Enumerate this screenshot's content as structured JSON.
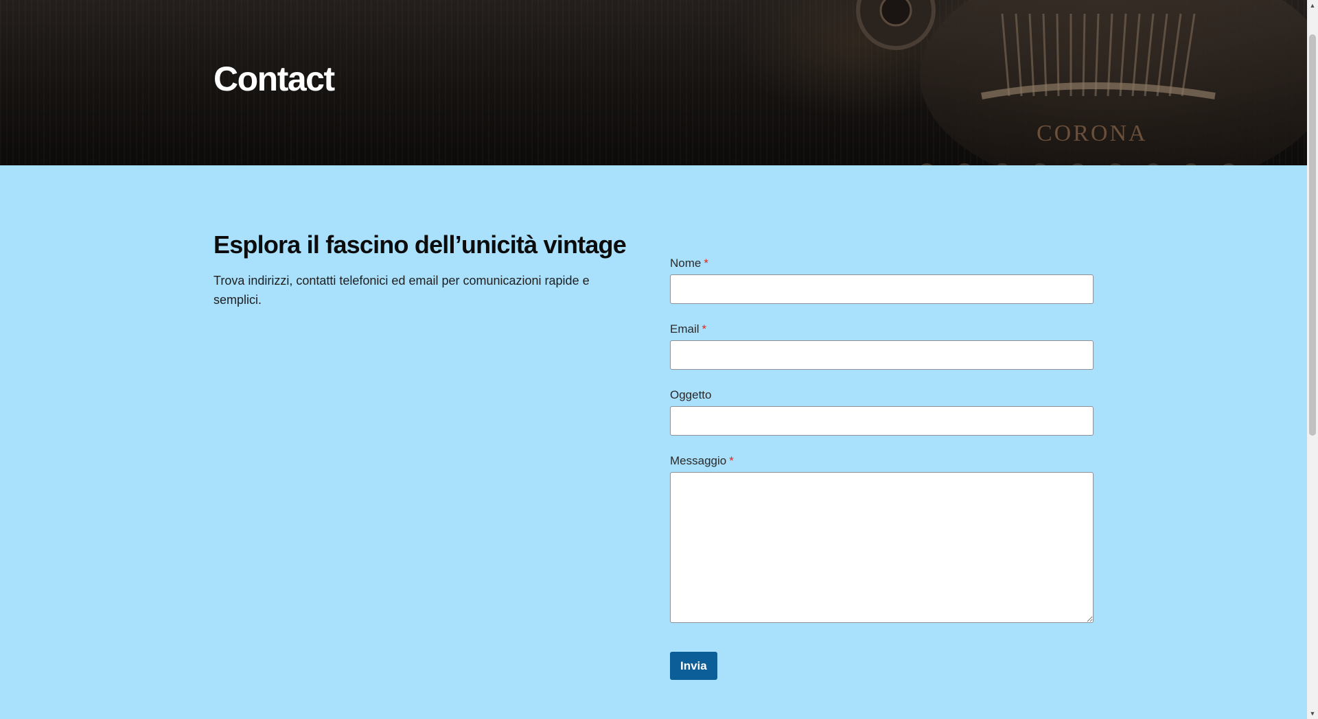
{
  "hero": {
    "title": "Contact",
    "background": "vintage-typewriter-photo",
    "typewriter_brand": "CORONA"
  },
  "intro": {
    "heading": "Esplora il fascino dell’unicità vintage",
    "text": "Trova indirizzi, contatti telefonici ed email per comunicazioni rapide e semplici."
  },
  "form": {
    "fields": [
      {
        "label": "Nome",
        "required": true,
        "value": ""
      },
      {
        "label": "Email",
        "required": true,
        "value": ""
      },
      {
        "label": "Oggetto",
        "required": false,
        "value": ""
      },
      {
        "label": "Messaggio",
        "required": true,
        "value": ""
      }
    ],
    "required_marker": "*",
    "submit_label": "Invia"
  },
  "colors": {
    "page_background": "#a9e0fb",
    "button": "#0b5e98",
    "required": "#e2261c"
  }
}
